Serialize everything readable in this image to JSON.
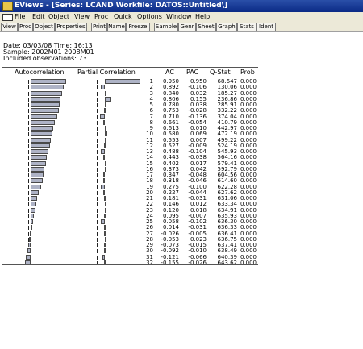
{
  "window": {
    "title": "EViews - [Series: LCAND   Workfile: DATOS::Untitled\\]"
  },
  "menu": [
    "File",
    "Edit",
    "Object",
    "View",
    "Proc",
    "Quick",
    "Options",
    "Window",
    "Help"
  ],
  "toolbar": [
    "View",
    "Proc",
    "Object",
    "Properties",
    "Print",
    "Name",
    "Freeze",
    "Sample",
    "Genr",
    "Sheet",
    "Graph",
    "Stats",
    "Ident"
  ],
  "info": {
    "date_line": "Date: 03/03/08   Time: 16:13",
    "sample_line": "Sample: 2002M01 2008M01",
    "obs_line": "Included observations: 73"
  },
  "headers": {
    "autocorrelation": "Autocorrelation",
    "partial": "Partial Correlation",
    "ac": "AC",
    "pac": "PAC",
    "qstat": "Q-Stat",
    "prob": "Prob"
  },
  "rows": [
    {
      "lag": "1",
      "ac": "0.950",
      "pac": "0.950",
      "q": "68.647",
      "prob": "0.000"
    },
    {
      "lag": "2",
      "ac": "0.892",
      "pac": "-0.106",
      "q": "130.06",
      "prob": "0.000"
    },
    {
      "lag": "3",
      "ac": "0.840",
      "pac": "0.032",
      "q": "185.27",
      "prob": "0.000"
    },
    {
      "lag": "4",
      "ac": "0.806",
      "pac": "0.155",
      "q": "236.86",
      "prob": "0.000"
    },
    {
      "lag": "5",
      "ac": "0.780",
      "pac": "0.038",
      "q": "285.91",
      "prob": "0.000"
    },
    {
      "lag": "6",
      "ac": "0.753",
      "pac": "-0.028",
      "q": "332.22",
      "prob": "0.000"
    },
    {
      "lag": "7",
      "ac": "0.710",
      "pac": "-0.136",
      "q": "374.04",
      "prob": "0.000"
    },
    {
      "lag": "8",
      "ac": "0.661",
      "pac": "-0.054",
      "q": "410.79",
      "prob": "0.000"
    },
    {
      "lag": "9",
      "ac": "0.613",
      "pac": "0.010",
      "q": "442.97",
      "prob": "0.000"
    },
    {
      "lag": "10",
      "ac": "0.580",
      "pac": "0.069",
      "q": "472.19",
      "prob": "0.000"
    },
    {
      "lag": "11",
      "ac": "0.553",
      "pac": "0.007",
      "q": "499.22",
      "prob": "0.000"
    },
    {
      "lag": "12",
      "ac": "0.527",
      "pac": "-0.009",
      "q": "524.19",
      "prob": "0.000"
    },
    {
      "lag": "13",
      "ac": "0.488",
      "pac": "-0.104",
      "q": "545.93",
      "prob": "0.000"
    },
    {
      "lag": "14",
      "ac": "0.443",
      "pac": "-0.038",
      "q": "564.16",
      "prob": "0.000"
    },
    {
      "lag": "15",
      "ac": "0.402",
      "pac": "0.017",
      "q": "579.41",
      "prob": "0.000"
    },
    {
      "lag": "16",
      "ac": "0.373",
      "pac": "0.042",
      "q": "592.79",
      "prob": "0.000"
    },
    {
      "lag": "17",
      "ac": "0.347",
      "pac": "-0.048",
      "q": "604.56",
      "prob": "0.000"
    },
    {
      "lag": "18",
      "ac": "0.318",
      "pac": "-0.046",
      "q": "614.60",
      "prob": "0.000"
    },
    {
      "lag": "19",
      "ac": "0.275",
      "pac": "-0.100",
      "q": "622.28",
      "prob": "0.000"
    },
    {
      "lag": "20",
      "ac": "0.227",
      "pac": "-0.044",
      "q": "627.62",
      "prob": "0.000"
    },
    {
      "lag": "21",
      "ac": "0.181",
      "pac": "-0.031",
      "q": "631.06",
      "prob": "0.000"
    },
    {
      "lag": "22",
      "ac": "0.146",
      "pac": "0.012",
      "q": "633.34",
      "prob": "0.000"
    },
    {
      "lag": "23",
      "ac": "0.120",
      "pac": "0.018",
      "q": "634.91",
      "prob": "0.000"
    },
    {
      "lag": "24",
      "ac": "0.095",
      "pac": "-0.007",
      "q": "635.93",
      "prob": "0.000"
    },
    {
      "lag": "25",
      "ac": "0.058",
      "pac": "-0.102",
      "q": "636.30",
      "prob": "0.000"
    },
    {
      "lag": "26",
      "ac": "0.014",
      "pac": "-0.031",
      "q": "636.33",
      "prob": "0.000"
    },
    {
      "lag": "27",
      "ac": "-0.026",
      "pac": "-0.005",
      "q": "636.41",
      "prob": "0.000"
    },
    {
      "lag": "28",
      "ac": "-0.053",
      "pac": "0.023",
      "q": "636.75",
      "prob": "0.000"
    },
    {
      "lag": "29",
      "ac": "-0.073",
      "pac": "-0.015",
      "q": "637.41",
      "prob": "0.000"
    },
    {
      "lag": "30",
      "ac": "-0.092",
      "pac": "-0.010",
      "q": "638.49",
      "prob": "0.000"
    },
    {
      "lag": "31",
      "ac": "-0.121",
      "pac": "-0.066",
      "q": "640.39",
      "prob": "0.000"
    },
    {
      "lag": "32",
      "ac": "-0.155",
      "pac": "-0.026",
      "q": "643.62",
      "prob": "0.000"
    }
  ]
}
